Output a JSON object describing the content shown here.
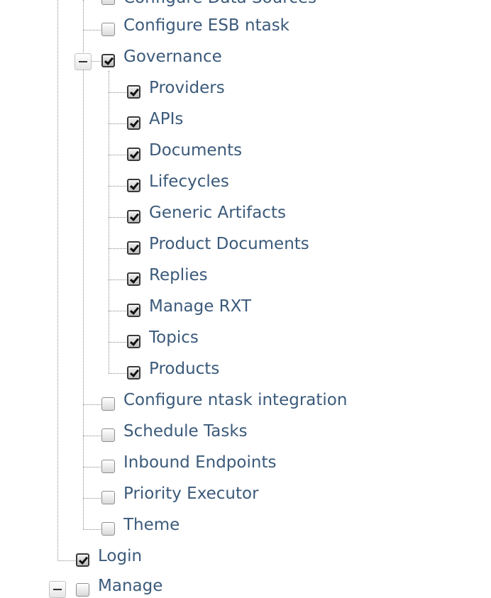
{
  "tree": {
    "top_partial_item": {
      "label": "Configure Data Sources",
      "checked": false
    },
    "items": [
      {
        "label": "Configure ESB ntask",
        "checked": false
      },
      {
        "label": "Governance",
        "checked": true,
        "expanded": true,
        "toggle_icon": "minus-icon"
      },
      {
        "label": "Providers",
        "checked": true
      },
      {
        "label": "APIs",
        "checked": true
      },
      {
        "label": "Documents",
        "checked": true
      },
      {
        "label": "Lifecycles",
        "checked": true
      },
      {
        "label": "Generic Artifacts",
        "checked": true
      },
      {
        "label": "Product Documents",
        "checked": true
      },
      {
        "label": "Replies",
        "checked": true
      },
      {
        "label": "Manage RXT",
        "checked": true
      },
      {
        "label": "Topics",
        "checked": true
      },
      {
        "label": "Products",
        "checked": true
      },
      {
        "label": "Configure ntask integration",
        "checked": false
      },
      {
        "label": "Schedule Tasks",
        "checked": false
      },
      {
        "label": "Inbound Endpoints",
        "checked": false
      },
      {
        "label": "Priority Executor",
        "checked": false
      },
      {
        "label": "Theme",
        "checked": false
      },
      {
        "label": "Login",
        "checked": true
      },
      {
        "label": "Manage",
        "checked": false,
        "expanded": true,
        "toggle_icon": "minus-icon"
      }
    ]
  },
  "colors": {
    "link": "#3b5a7a",
    "connector": "#8a8a8a"
  }
}
